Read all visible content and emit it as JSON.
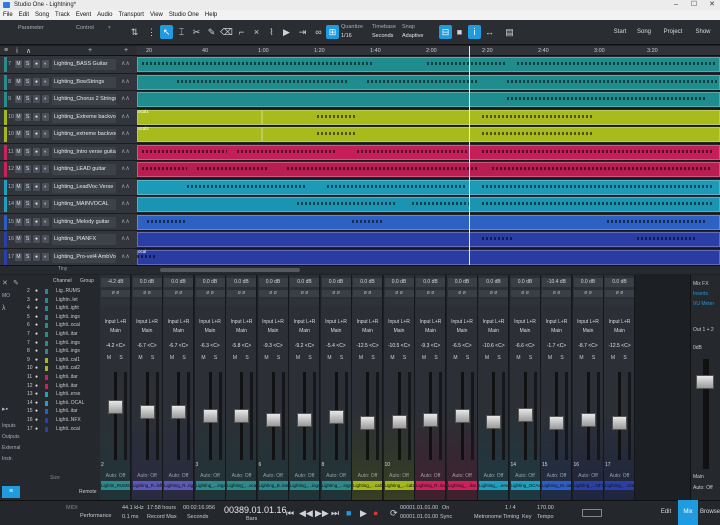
{
  "title": "Studio One - Lightning*",
  "menu": [
    "File",
    "Edit",
    "Song",
    "Track",
    "Event",
    "Audio",
    "Transport",
    "View",
    "Studio One",
    "Help"
  ],
  "toolbar": {
    "parameter_label": "Parameter",
    "control_label": "Control",
    "quantize_label": "Quantize",
    "quantize_value": "1/16",
    "timebase_label": "Timebase",
    "timebase_value": "Seconds",
    "snap_label": "Snap",
    "snap_value": "Adaptive",
    "start": "Start",
    "song": "Song",
    "project": "Project",
    "show": "Show"
  },
  "ruler": [
    "20",
    "40",
    "1:00",
    "1:20",
    "1:40",
    "2:00",
    "2:20",
    "2:40",
    "3:00",
    "3:20"
  ],
  "tracks": [
    {
      "num": "7",
      "name": "Lighting_BASS Guitar",
      "color": "#2a8a8c",
      "lane": "#1f8c8e"
    },
    {
      "num": "8",
      "name": "Lighting_BowStrings",
      "color": "#2a8a8c",
      "lane": "#1f8c8e"
    },
    {
      "num": "9",
      "name": "Lighting_Chorus 2 Strings",
      "color": "#2a8a8c",
      "lane": "#1f8c8e"
    },
    {
      "num": "10",
      "name": "Lighting_Extreme backvocal1",
      "color": "#a3b81c",
      "lane": "#a8bb1d"
    },
    {
      "num": "10",
      "name": "Lighting_extreme backvocal2",
      "color": "#a3b81c",
      "lane": "#a8bb1d"
    },
    {
      "num": "11",
      "name": "Lighting_Intro verse guitar",
      "color": "#d0205c",
      "lane": "#c41f58"
    },
    {
      "num": "12",
      "name": "Lighting_LEAD guitar",
      "color": "#d0205c",
      "lane": "#b81e52"
    },
    {
      "num": "13",
      "name": "Lighting_LeadVoc Verse",
      "color": "#1fa0c0",
      "lane": "#1c9ab8"
    },
    {
      "num": "14",
      "name": "Lighting_MAINVOCAL",
      "color": "#1fa0c0",
      "lane": "#1a94b2"
    },
    {
      "num": "15",
      "name": "Lighting_Melody guitar",
      "color": "#2a5fc8",
      "lane": "#2d62c4"
    },
    {
      "num": "16",
      "name": "Lighting_PIANFX",
      "color": "#2a3fa8",
      "lane": "#2b3ea6"
    },
    {
      "num": "17",
      "name": "Lighting_Pro-vel4 AmbVoice",
      "color": "#2a3fa8",
      "lane": "#2a3ca2"
    }
  ],
  "clip_labels": [
    "ocal1",
    "ocal2",
    "ocal"
  ],
  "console": {
    "header_channel": "Channel",
    "header_group": "Group",
    "size_label": "Size",
    "remote_label": "Remote",
    "tiny_label": "Tiny",
    "mo_label": "MO"
  },
  "sidebar": [
    "Inputs",
    "Outputs",
    "External",
    "Instr."
  ],
  "channel_list": [
    {
      "num": "2",
      "name": "Lig..RUMS",
      "color": "#2a8a8c"
    },
    {
      "num": "3",
      "name": "Lightn..let",
      "color": "#2a8a8c"
    },
    {
      "num": "4",
      "name": "Lighti..ight",
      "color": "#2a8a8c"
    },
    {
      "num": "5",
      "name": "Lighti..ings",
      "color": "#2a8a8c"
    },
    {
      "num": "6",
      "name": "Lighti..ocal",
      "color": "#2a8a8c"
    },
    {
      "num": "7",
      "name": "Lighti..itar",
      "color": "#2a8a8c"
    },
    {
      "num": "7",
      "name": "Lighti..ings",
      "color": "#2a8a8c"
    },
    {
      "num": "8",
      "name": "Lighti..ings",
      "color": "#2a8a8c"
    },
    {
      "num": "9",
      "name": "Lighti..cal1",
      "color": "#a3b81c"
    },
    {
      "num": "10",
      "name": "Lighti..cal2",
      "color": "#a3b81c"
    },
    {
      "num": "11",
      "name": "Lighti..itar",
      "color": "#d0205c"
    },
    {
      "num": "12",
      "name": "Lighti..itar",
      "color": "#d0205c"
    },
    {
      "num": "13",
      "name": "Lighti..erse",
      "color": "#1fa0c0"
    },
    {
      "num": "14",
      "name": "Lighti..OCAL",
      "color": "#1fa0c0"
    },
    {
      "num": "15",
      "name": "Lighti..itar",
      "color": "#2a5fc8"
    },
    {
      "num": "16",
      "name": "Lighti..NFX",
      "color": "#2a3fa8"
    },
    {
      "num": "17",
      "name": "Lighti..ocal",
      "color": "#2a3fa8"
    }
  ],
  "channels": [
    {
      "top": "-4.2 dB",
      "pan": "-4.2",
      "num": "2",
      "name": "Lightin_RUMS",
      "color": "#2a8a8c",
      "level": 0.62
    },
    {
      "top": "0.0 dB",
      "pan": "-6.7",
      "num": "",
      "name": "Lighting_R..left",
      "color": "#5a58b8",
      "level": 0.55
    },
    {
      "top": "0.0 dB",
      "pan": "-6.7",
      "num": "",
      "name": "Lighting_R..right",
      "color": "#5a58b8",
      "level": 0.55
    },
    {
      "top": "0.0 dB",
      "pan": "-6.3",
      "num": "3",
      "name": "Lighting_...ings",
      "color": "#2a8a8c",
      "level": 0.5
    },
    {
      "top": "0.0 dB",
      "pan": "-5.8",
      "num": "",
      "name": "Lighting_...ocal",
      "color": "#2a8a8c",
      "level": 0.5
    },
    {
      "top": "0.0 dB",
      "pan": "-9.3",
      "num": "6",
      "name": "Lighting_B..itar",
      "color": "#2a8a8c",
      "level": 0.45
    },
    {
      "top": "0.0 dB",
      "pan": "-9.2",
      "num": "",
      "name": "Lighting_...ings",
      "color": "#2a8a8c",
      "level": 0.45
    },
    {
      "top": "0.0 dB",
      "pan": "-5.4",
      "num": "8",
      "name": "Lighting_...ings",
      "color": "#2a8a8c",
      "level": 0.48
    },
    {
      "top": "0.0 dB",
      "pan": "-12.5",
      "num": "",
      "name": "Lighting_...cal1",
      "color": "#a3b81c",
      "level": 0.4
    },
    {
      "top": "0.0 dB",
      "pan": "-10.5",
      "num": "10",
      "name": "Lighting_...cal2",
      "color": "#a3b81c",
      "level": 0.42
    },
    {
      "top": "0.0 dB",
      "pan": "-9.3",
      "num": "",
      "name": "Lighting_R..itar",
      "color": "#d0205c",
      "level": 0.45
    },
    {
      "top": "0.0 dB",
      "pan": "-6.5",
      "num": "",
      "name": "Lighting_...itar",
      "color": "#d0205c",
      "level": 0.5
    },
    {
      "top": "0.0 dB",
      "pan": "-10.6",
      "num": "",
      "name": "Lighting_...erse",
      "color": "#1fa0c0",
      "level": 0.42
    },
    {
      "top": "0.0 dB",
      "pan": "-6.6",
      "num": "14",
      "name": "Lighting_OCAL",
      "color": "#1fa0c0",
      "level": 0.52
    },
    {
      "top": "-10.4 dB",
      "pan": "-1.7",
      "num": "15",
      "name": "Lighting_M..itar",
      "color": "#2a5fc8",
      "level": 0.4
    },
    {
      "top": "0.0 dB",
      "pan": "-8.7",
      "num": "16",
      "name": "Lighting_...NFX",
      "color": "#2a3fa8",
      "level": 0.45
    },
    {
      "top": "0.0 dB",
      "pan": "-12.5",
      "num": "17",
      "name": "Lighting_...ocal",
      "color": "#2a3fa8",
      "level": 0.4
    }
  ],
  "channel_common": {
    "io": "Input L+R",
    "main": "Main",
    "auto": "Auto: Off",
    "m": "M",
    "s": "S"
  },
  "mix_right": {
    "mix_fx": "Mix FX",
    "inserts": "Inserts",
    "vu": "VU Meter",
    "out": "Out 1 + 2",
    "main_val": "0dB",
    "main_label": "Main",
    "auto": "Auto: Off"
  },
  "transport": {
    "sample_rate": "44.1 kHz",
    "latency": "0.1 ms",
    "record": "17:58 hours",
    "record_label": "Record Max",
    "time": "00:02:16.956",
    "time_label": "Seconds",
    "position": "00389.01.01.16",
    "position_label": "Bars",
    "midi_label": "MIDI",
    "performance_label": "Performance",
    "left_pos": "00001.01.01.00",
    "right_pos": "00001.01.01.00",
    "on": "On",
    "sync_label": "Sync",
    "metronome": "Metronome",
    "timing": "Timing",
    "sig": "1 / 4",
    "key": "Key",
    "tempo": "170.00",
    "tempo_label": "Tempo"
  },
  "tabs": {
    "edit": "Edit",
    "mix": "Mix",
    "browse": "Browse"
  }
}
